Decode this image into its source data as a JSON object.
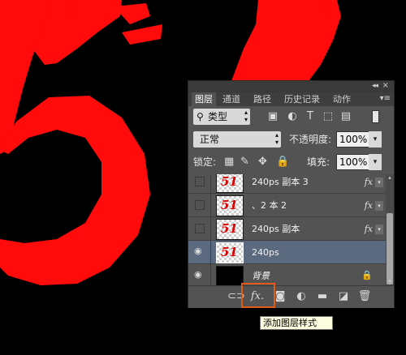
{
  "canvas": {
    "background": "#000000",
    "art_color": "#ff0b0b",
    "art_text": "51"
  },
  "panel": {
    "tabs": [
      "图层",
      "通道",
      "路径",
      "历史记录",
      "动作"
    ],
    "active_tab": "图层",
    "filter": {
      "search_icon": "search-icon",
      "label": "类型"
    },
    "blend_mode": "正常",
    "opacity_label": "不透明度:",
    "opacity_value": "100%",
    "lock_label": "锁定:",
    "fill_label": "填充:",
    "fill_value": "100%",
    "layers": [
      {
        "name": "240ps 副本 3",
        "visible": false,
        "fx": "fx",
        "selected": false,
        "thumb": "51"
      },
      {
        "name": "、2 本 2",
        "visible": false,
        "fx": "fx",
        "selected": false,
        "thumb": "51"
      },
      {
        "name": "240ps 副本",
        "visible": false,
        "fx": "fx",
        "selected": false,
        "thumb": "51"
      },
      {
        "name": "240ps",
        "visible": true,
        "fx": "",
        "selected": true,
        "thumb": "51"
      },
      {
        "name": "背景",
        "visible": true,
        "fx": "",
        "selected": false,
        "thumb": "",
        "locked": true
      }
    ],
    "bottom_icons": [
      "link-icon",
      "fx-icon",
      "mask-icon",
      "adjustment-icon",
      "folder-icon",
      "new-layer-icon",
      "trash-icon"
    ],
    "fx_label": "fx."
  },
  "tooltip": "添加图层样式",
  "highlight_color": "#e05a1c"
}
